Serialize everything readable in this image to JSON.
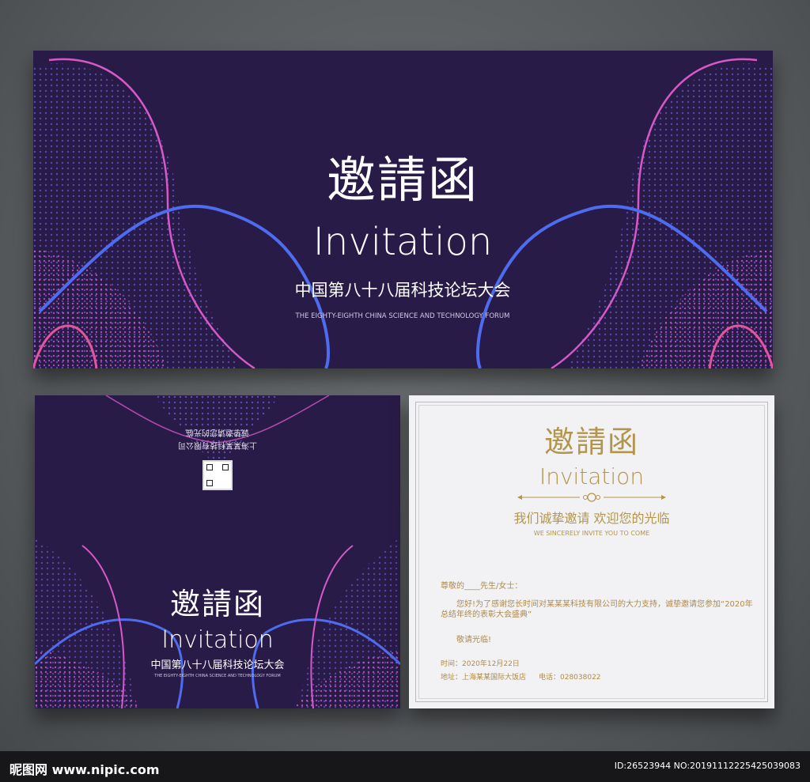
{
  "top_card": {
    "title": "邀請函",
    "subtitle_en": "Invitation",
    "forum_cn": "中国第八十八届科技论坛大会",
    "forum_en": "THE EIGHTY-EIGHTH CHINA SCIENCE AND TECHNOLOGY FORUM"
  },
  "back_card": {
    "mirror_line1": "诚挚邀请您的光临",
    "mirror_line2": "上海某某科技有限公司",
    "title": "邀請函",
    "subtitle_en": "Invitation",
    "forum_cn": "中国第八十八届科技论坛大会",
    "forum_en": "THE EIGHTY-EIGHTH CHINA SCIENCE AND TECHNOLOGY FORUM"
  },
  "inner_card": {
    "title": "邀請函",
    "subtitle_en": "Invitation",
    "tagline_cn": "我们诚挚邀请 欢迎您的光临",
    "tagline_en": "WE SINCERELY INVITE YOU TO COME",
    "greeting": "尊敬的____先生/女士：",
    "body": "您好!为了感谢您长时间对某某某科技有限公司的大力支持，诚挚邀请您参加“2020年总结年终的表彰大会盛典”",
    "closing": "敬请光临!",
    "time": "时间：2020年12月22日",
    "address": "地址：上海某某国际大饭店",
    "phone": "电话：028038022"
  },
  "footer": {
    "logo": "昵图网 www.nipic.com",
    "id_text": "ID:26523944 NO:20191112225425039083"
  },
  "colors": {
    "card_bg": "#291b47",
    "wave_blue": "#4e6cf0",
    "wave_pink": "#e45ad0",
    "gold": "#b3954d"
  }
}
